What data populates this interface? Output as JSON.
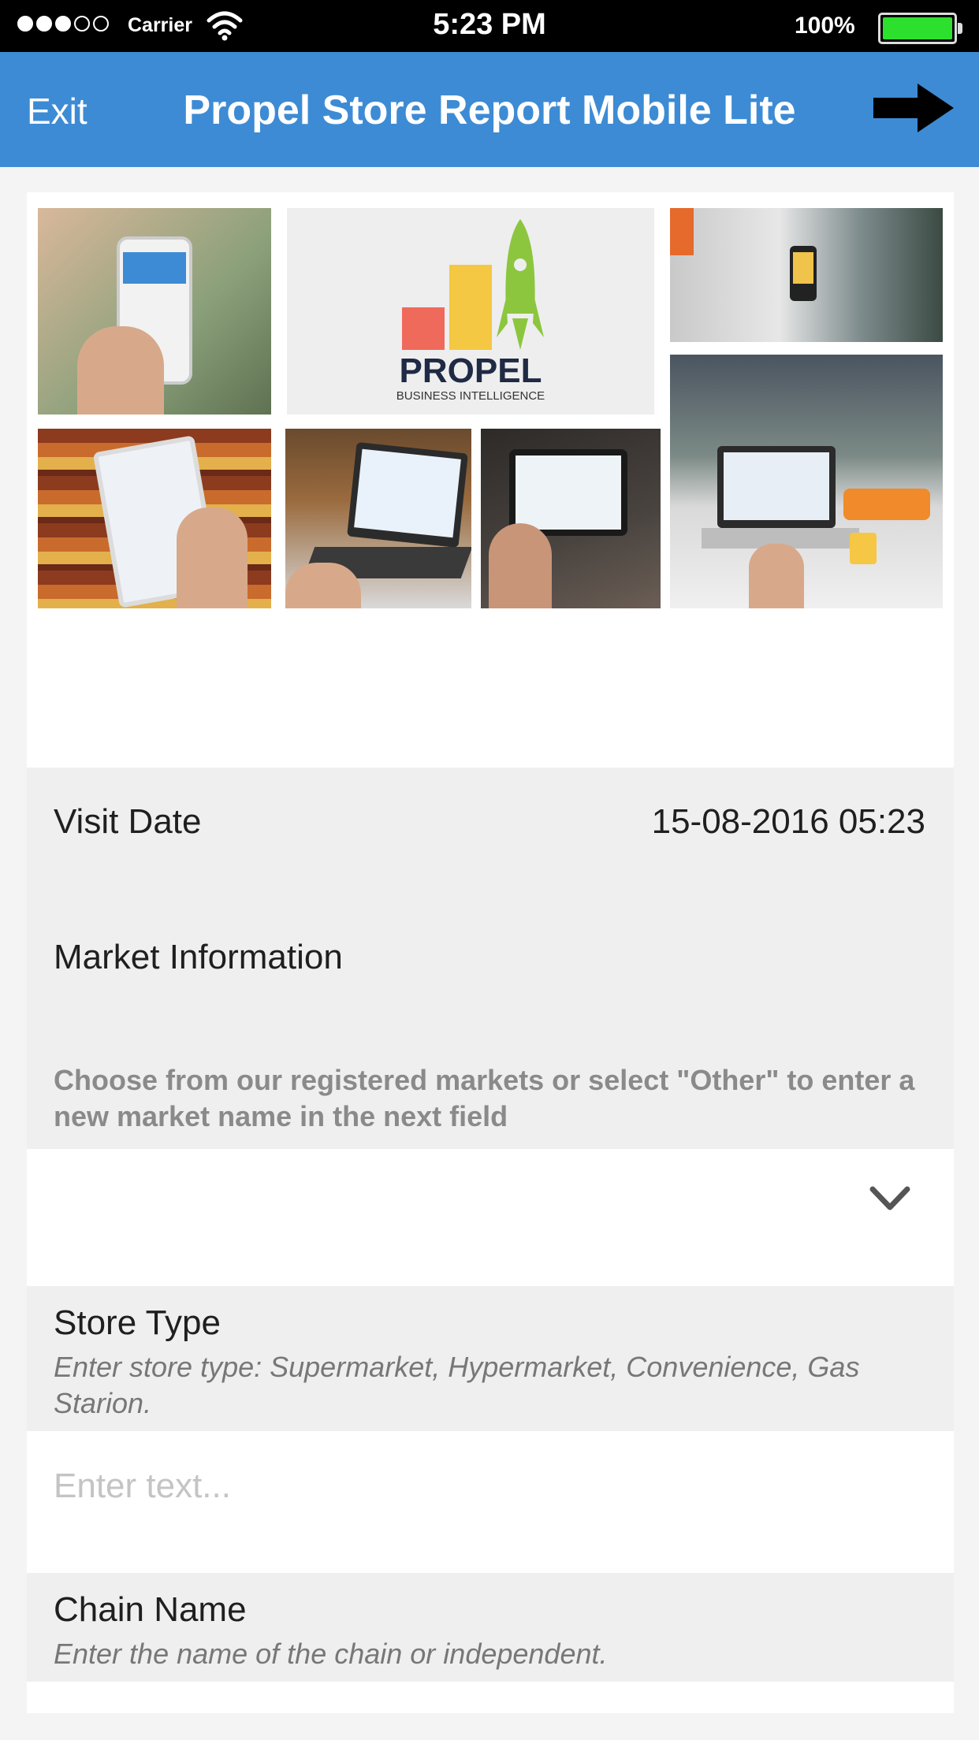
{
  "status_bar": {
    "carrier": "Carrier",
    "time": "5:23 PM",
    "battery": "100%",
    "signal_bars_filled": 3,
    "signal_bars_total": 5
  },
  "nav": {
    "exit_label": "Exit",
    "title": "Propel Store Report Mobile Lite",
    "next_icon": "arrow-right-icon",
    "bar_color": "#3d8bd4"
  },
  "header_image": {
    "logo_text": "PROPEL",
    "logo_tagline": "BUSINESS INTELLIGENCE",
    "tiles": [
      "phone-in-hand-photo",
      "propel-logo",
      "city-phone-photo",
      "office-laptop-photo",
      "tablet-store-shelf-photo",
      "laptop-dashboard-photo",
      "tablet-dashboard-photo"
    ]
  },
  "visit_date": {
    "label": "Visit Date",
    "value": "15-08-2016 05:23"
  },
  "market": {
    "label": "Market Information",
    "help": "Choose from our registered markets or select \"Other\" to enter a new market name in the next field",
    "selected_value": "",
    "dropdown_icon": "chevron-down-icon"
  },
  "store_type": {
    "label": "Store Type",
    "hint": "Enter store type: Supermarket, Hypermarket, Convenience, Gas Starion.",
    "placeholder": "Enter text..."
  },
  "chain_name": {
    "label": "Chain Name",
    "hint": "Enter the name of the chain or independent."
  }
}
